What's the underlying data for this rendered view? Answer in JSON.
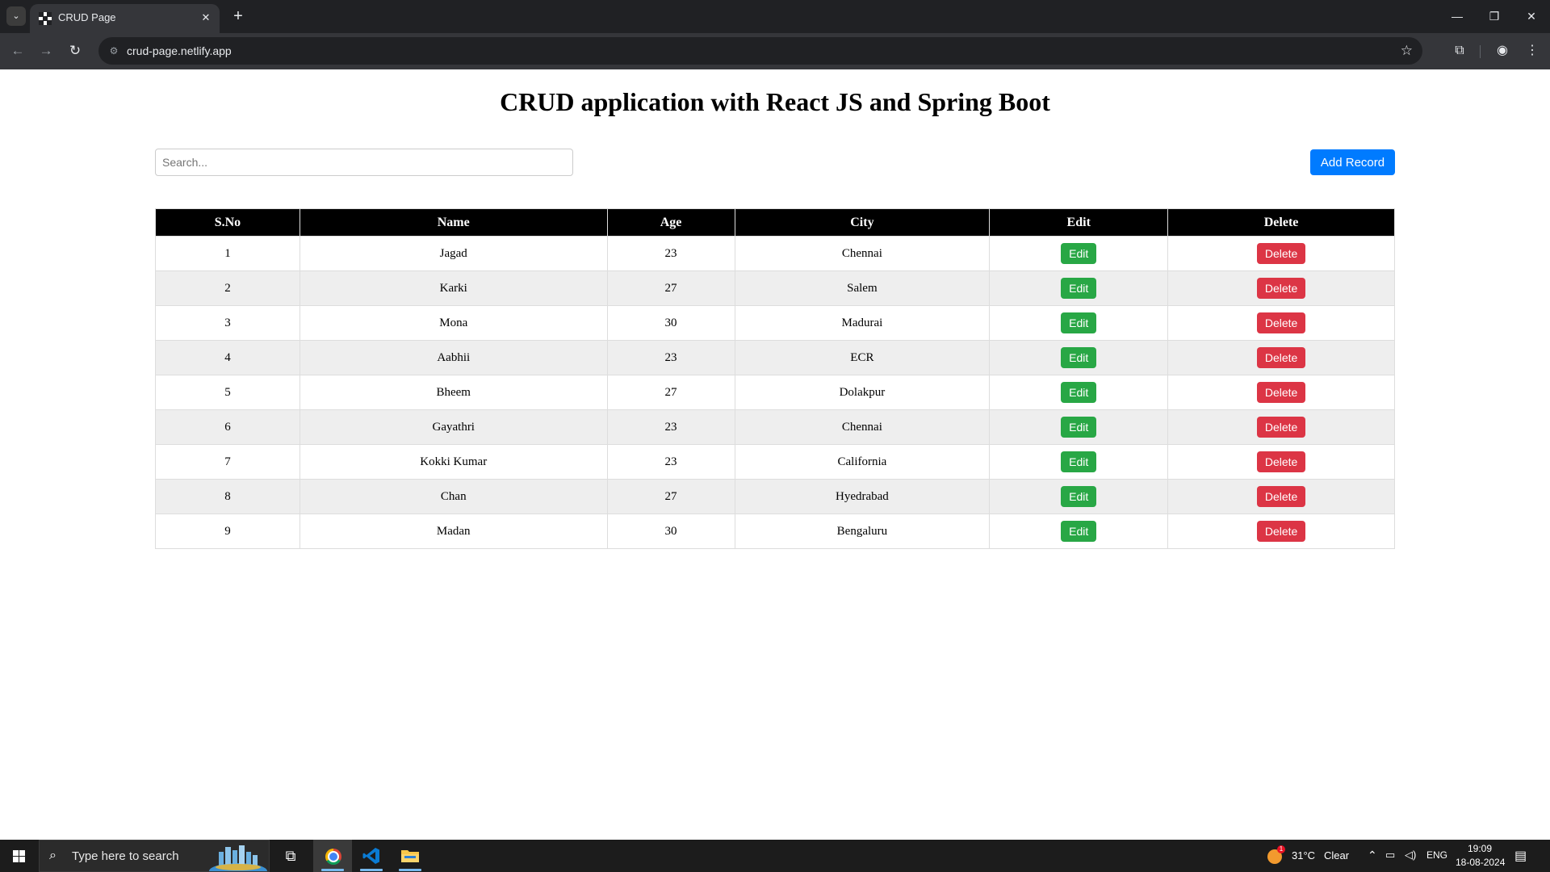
{
  "browser": {
    "tab_title": "CRUD Page",
    "tab_close": "✕",
    "new_tab": "+",
    "url": "crud-page.netlify.app",
    "window_controls": [
      "—",
      "❐",
      "✕"
    ]
  },
  "page": {
    "title": "CRUD application with React JS and Spring Boot",
    "search_placeholder": "Search...",
    "add_button": "Add Record"
  },
  "table": {
    "headers": [
      "S.No",
      "Name",
      "Age",
      "City",
      "Edit",
      "Delete"
    ],
    "edit_label": "Edit",
    "delete_label": "Delete",
    "rows": [
      {
        "sno": "1",
        "name": "Jagad",
        "age": "23",
        "city": "Chennai"
      },
      {
        "sno": "2",
        "name": "Karki",
        "age": "27",
        "city": "Salem"
      },
      {
        "sno": "3",
        "name": "Mona",
        "age": "30",
        "city": "Madurai"
      },
      {
        "sno": "4",
        "name": "Aabhii",
        "age": "23",
        "city": "ECR"
      },
      {
        "sno": "5",
        "name": "Bheem",
        "age": "27",
        "city": "Dolakpur"
      },
      {
        "sno": "6",
        "name": "Gayathri",
        "age": "23",
        "city": "Chennai"
      },
      {
        "sno": "7",
        "name": "Kokki Kumar",
        "age": "23",
        "city": "California"
      },
      {
        "sno": "8",
        "name": "Chan",
        "age": "27",
        "city": "Hyedrabad"
      },
      {
        "sno": "9",
        "name": "Madan",
        "age": "30",
        "city": "Bengaluru"
      }
    ]
  },
  "taskbar": {
    "search_placeholder": "Type here to search",
    "weather_temp": "31°C",
    "weather_desc": "Clear",
    "weather_badge": "1",
    "language": "ENG",
    "time": "19:09",
    "date": "18-08-2024"
  },
  "colors": {
    "accent": "#007bff",
    "edit": "#28a745",
    "delete": "#dc3545",
    "header_bg": "#000000"
  }
}
